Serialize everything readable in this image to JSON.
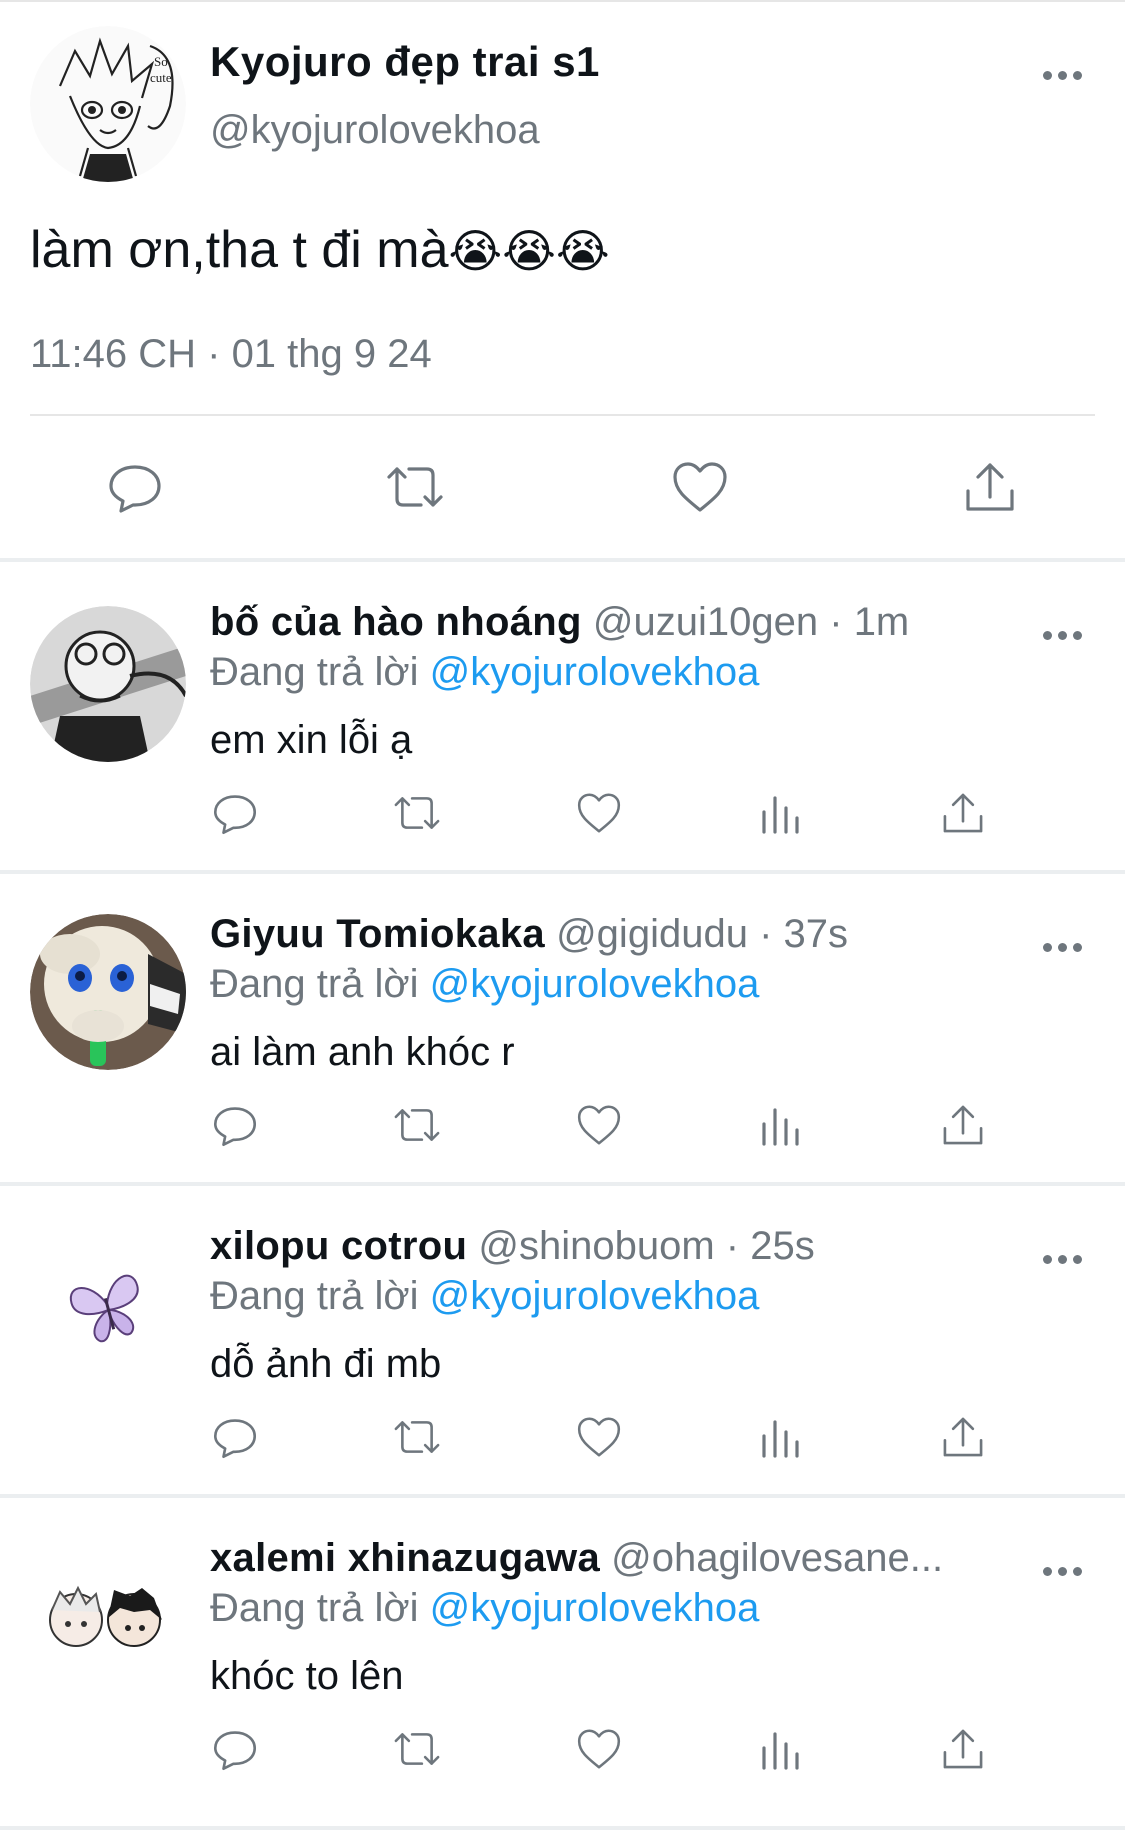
{
  "main_tweet": {
    "display_name": "Kyojuro đẹp trai s1",
    "handle": "@kyojurolovekhoa",
    "text": "làm ơn,tha t đi mà",
    "emojis": "😭😭😭",
    "timestamp": "11:46 CH · 01 thg 9 24",
    "avatar_icon": "anime-avatar-icon",
    "actions": [
      "reply-icon",
      "retweet-icon",
      "like-icon",
      "share-icon"
    ]
  },
  "replies": [
    {
      "display_name": "bố của hào nhoáng",
      "handle": "@uzui10gen",
      "time": "1m",
      "replying_label": "Đang trả lời",
      "replying_to": "@kyojurolovekhoa",
      "text": "em xin lỗi ạ",
      "avatar_icon": "manga-avatar-icon"
    },
    {
      "display_name": "Giyuu Tomiokaka",
      "handle": "@gigidudu",
      "time": "37s",
      "replying_label": "Đang trả lời",
      "replying_to": "@kyojurolovekhoa",
      "text": "ai làm anh khóc r",
      "avatar_icon": "plush-doll-avatar-icon"
    },
    {
      "display_name": "xilopu cotrou",
      "handle": "@shinobuom",
      "time": "25s",
      "replying_label": "Đang trả lời",
      "replying_to": "@kyojurolovekhoa",
      "text": "dỗ ảnh đi mb",
      "avatar_icon": "butterfly-avatar-icon"
    },
    {
      "display_name": "xalemi xhinazugawa",
      "handle": "@ohagilovesane...",
      "time": "",
      "replying_label": "Đang trả lời",
      "replying_to": "@kyojurolovekhoa",
      "text": "khóc to lên",
      "avatar_icon": "chibi-pair-avatar-icon"
    }
  ],
  "colors": {
    "text": "#0f1419",
    "secondary": "#6e767d",
    "mention": "#1d9bf0",
    "divider": "#ebeef0"
  }
}
